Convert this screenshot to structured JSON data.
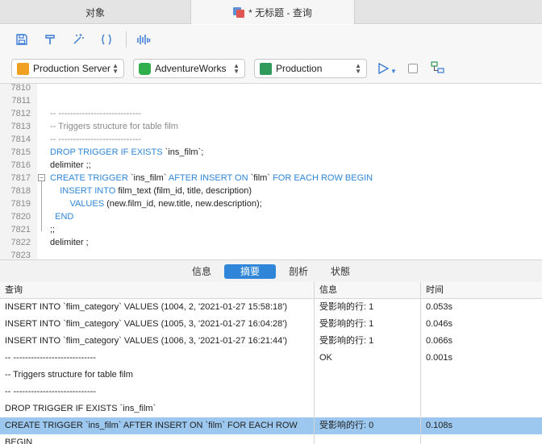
{
  "tabs": [
    {
      "label": "对象"
    },
    {
      "label": "* 无标题 - 查询"
    }
  ],
  "connection": {
    "server": "Production Server",
    "database": "AdventureWorks",
    "schema": "Production"
  },
  "editor": {
    "lines": [
      {
        "num": "7810",
        "text": ""
      },
      {
        "num": "7811",
        "text": ""
      },
      {
        "num": "7812",
        "text": "-- ----------------------------"
      },
      {
        "num": "7813",
        "text": "-- Triggers structure for table film"
      },
      {
        "num": "7814",
        "text": "-- ----------------------------"
      },
      {
        "num": "7815",
        "text": "DROP TRIGGER IF EXISTS `ins_film`;"
      },
      {
        "num": "7816",
        "text": "delimiter ;;"
      },
      {
        "num": "7817",
        "text": "CREATE TRIGGER `ins_film` AFTER INSERT ON `film` FOR EACH ROW BEGIN"
      },
      {
        "num": "7818",
        "text": "    INSERT INTO film_text (film_id, title, description)"
      },
      {
        "num": "7819",
        "text": "        VALUES (new.film_id, new.title, new.description);"
      },
      {
        "num": "7820",
        "text": "  END"
      },
      {
        "num": "7821",
        "text": ";;"
      },
      {
        "num": "7822",
        "text": "delimiter ;"
      },
      {
        "num": "7823",
        "text": ""
      }
    ]
  },
  "result_tabs": [
    {
      "label": "信息"
    },
    {
      "label": "摘要"
    },
    {
      "label": "剖析"
    },
    {
      "label": "状態"
    }
  ],
  "grid": {
    "headers": [
      "查询",
      "信息",
      "时间"
    ],
    "rows": [
      [
        "INSERT INTO `flim_category` VALUES (1004, 2, '2021-01-27 15:58:18')",
        "受影响的行: 1",
        "0.053s"
      ],
      [
        "INSERT INTO `flim_category` VALUES (1005, 3, '2021-01-27 16:04:28')",
        "受影响的行: 1",
        "0.046s"
      ],
      [
        "INSERT INTO `flim_category` VALUES (1006, 3, '2021-01-27 16:21:44')",
        "受影响的行: 1",
        "0.066s"
      ],
      [
        "-- ----------------------------",
        "OK",
        "0.001s"
      ],
      [
        "-- Triggers structure for table film",
        "",
        ""
      ],
      [
        "-- ----------------------------",
        "",
        ""
      ],
      [
        "DROP TRIGGER IF EXISTS `ins_film`",
        "",
        ""
      ],
      [
        "CREATE TRIGGER `ins_film` AFTER INSERT ON `film` FOR EACH ROW",
        "受影响的行: 0",
        "0.108s"
      ],
      [
        "BEGIN",
        "",
        ""
      ]
    ],
    "selected_row_index": 7
  },
  "colors": {
    "accent": "#2f86d8",
    "keyword": "#2f86d8",
    "comment": "#8a8a8a",
    "selection": "#9cc7ef"
  }
}
